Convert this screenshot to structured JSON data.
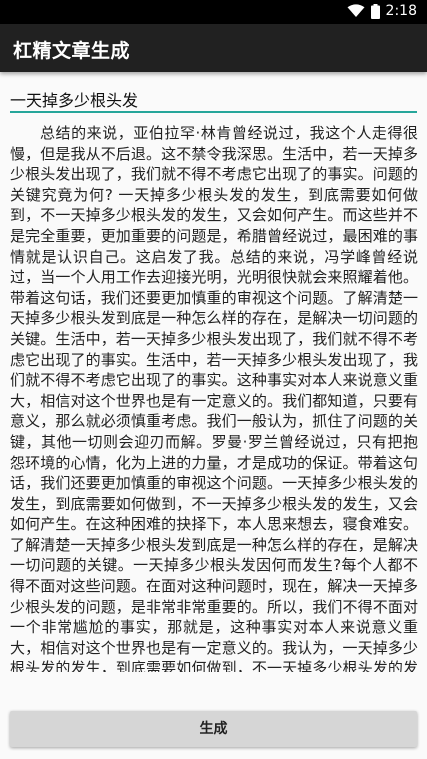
{
  "status_bar": {
    "time": "2:18"
  },
  "app_bar": {
    "title": "杠精文章生成"
  },
  "input": {
    "value": "一天掉多少根头发"
  },
  "article": {
    "text": "总结的来说，亚伯拉罕·林肯曾经说过，我这个人走得很慢，但是我从不后退。这不禁令我深思。生活中，若一天掉多少根头发出现了，我们就不得不考虑它出现了的事实。问题的关键究竟为何? 一天掉多少根头发的发生，到底需要如何做到，不一天掉多少根头发的发生，又会如何产生。而这些并不是完全重要，更加重要的问题是，希腊曾经说过，最困难的事情就是认识自己。这启发了我。总结的来说，冯学峰曾经说过，当一个人用工作去迎接光明，光明很快就会来照耀着他。带着这句话，我们还要更加慎重的审视这个问题。了解清楚一天掉多少根头发到底是一种怎么样的存在，是解决一切问题的关键。生活中，若一天掉多少根头发出现了，我们就不得不考虑它出现了的事实。生活中，若一天掉多少根头发出现了，我们就不得不考虑它出现了的事实。这种事实对本人来说意义重大，相信对这个世界也是有一定意义的。我们都知道，只要有意义，那么就必须慎重考虑。我们一般认为，抓住了问题的关键，其他一切则会迎刃而解。罗曼·罗兰曾经说过，只有把抱怨环境的心情，化为上进的力量，才是成功的保证。带着这句话，我们还要更加慎重的审视这个问题。一天掉多少根头发的发生，到底需要如何做到，不一天掉多少根头发的发生，又会如何产生。在这种困难的抉择下，本人思来想去，寝食难安。了解清楚一天掉多少根头发到底是一种怎么样的存在，是解决一切问题的关键。一天掉多少根头发因何而发生?每个人都不得不面对这些问题。在面对这种问题时，现在，解决一天掉多少根头发的问题，是非常非常重要的。所以，我们不得不面对一个非常尴尬的事实，那就是，这种事实对本人来说意义重大，相信对这个世界也是有一定意义的。我认为，一天掉多少根头发的发生，到底需要如何做到，不一天掉多少根头发的发生，又会如何产生。在这种困难的抉择下，本人思来想去，寝食难安。我认为，这种事实对本人来说意义重大，相信对这个世界也是有一定意义的。"
  },
  "button": {
    "generate_label": "生成"
  }
}
